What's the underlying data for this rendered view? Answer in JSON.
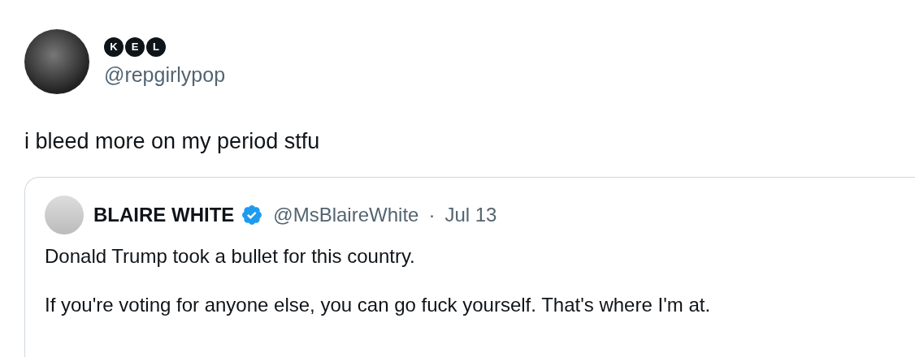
{
  "author": {
    "name_letters": [
      "K",
      "E",
      "L"
    ],
    "handle": "@repgirlypop"
  },
  "text": "i bleed more on my period stfu",
  "quote": {
    "name": "BLAIRE WHITE",
    "verified": true,
    "handle": "@MsBlaireWhite",
    "separator": "·",
    "date": "Jul 13",
    "paragraphs": [
      "Donald Trump took a bullet for this country.",
      "If you're voting for anyone else, you can go fuck yourself. That's where I'm at."
    ]
  }
}
